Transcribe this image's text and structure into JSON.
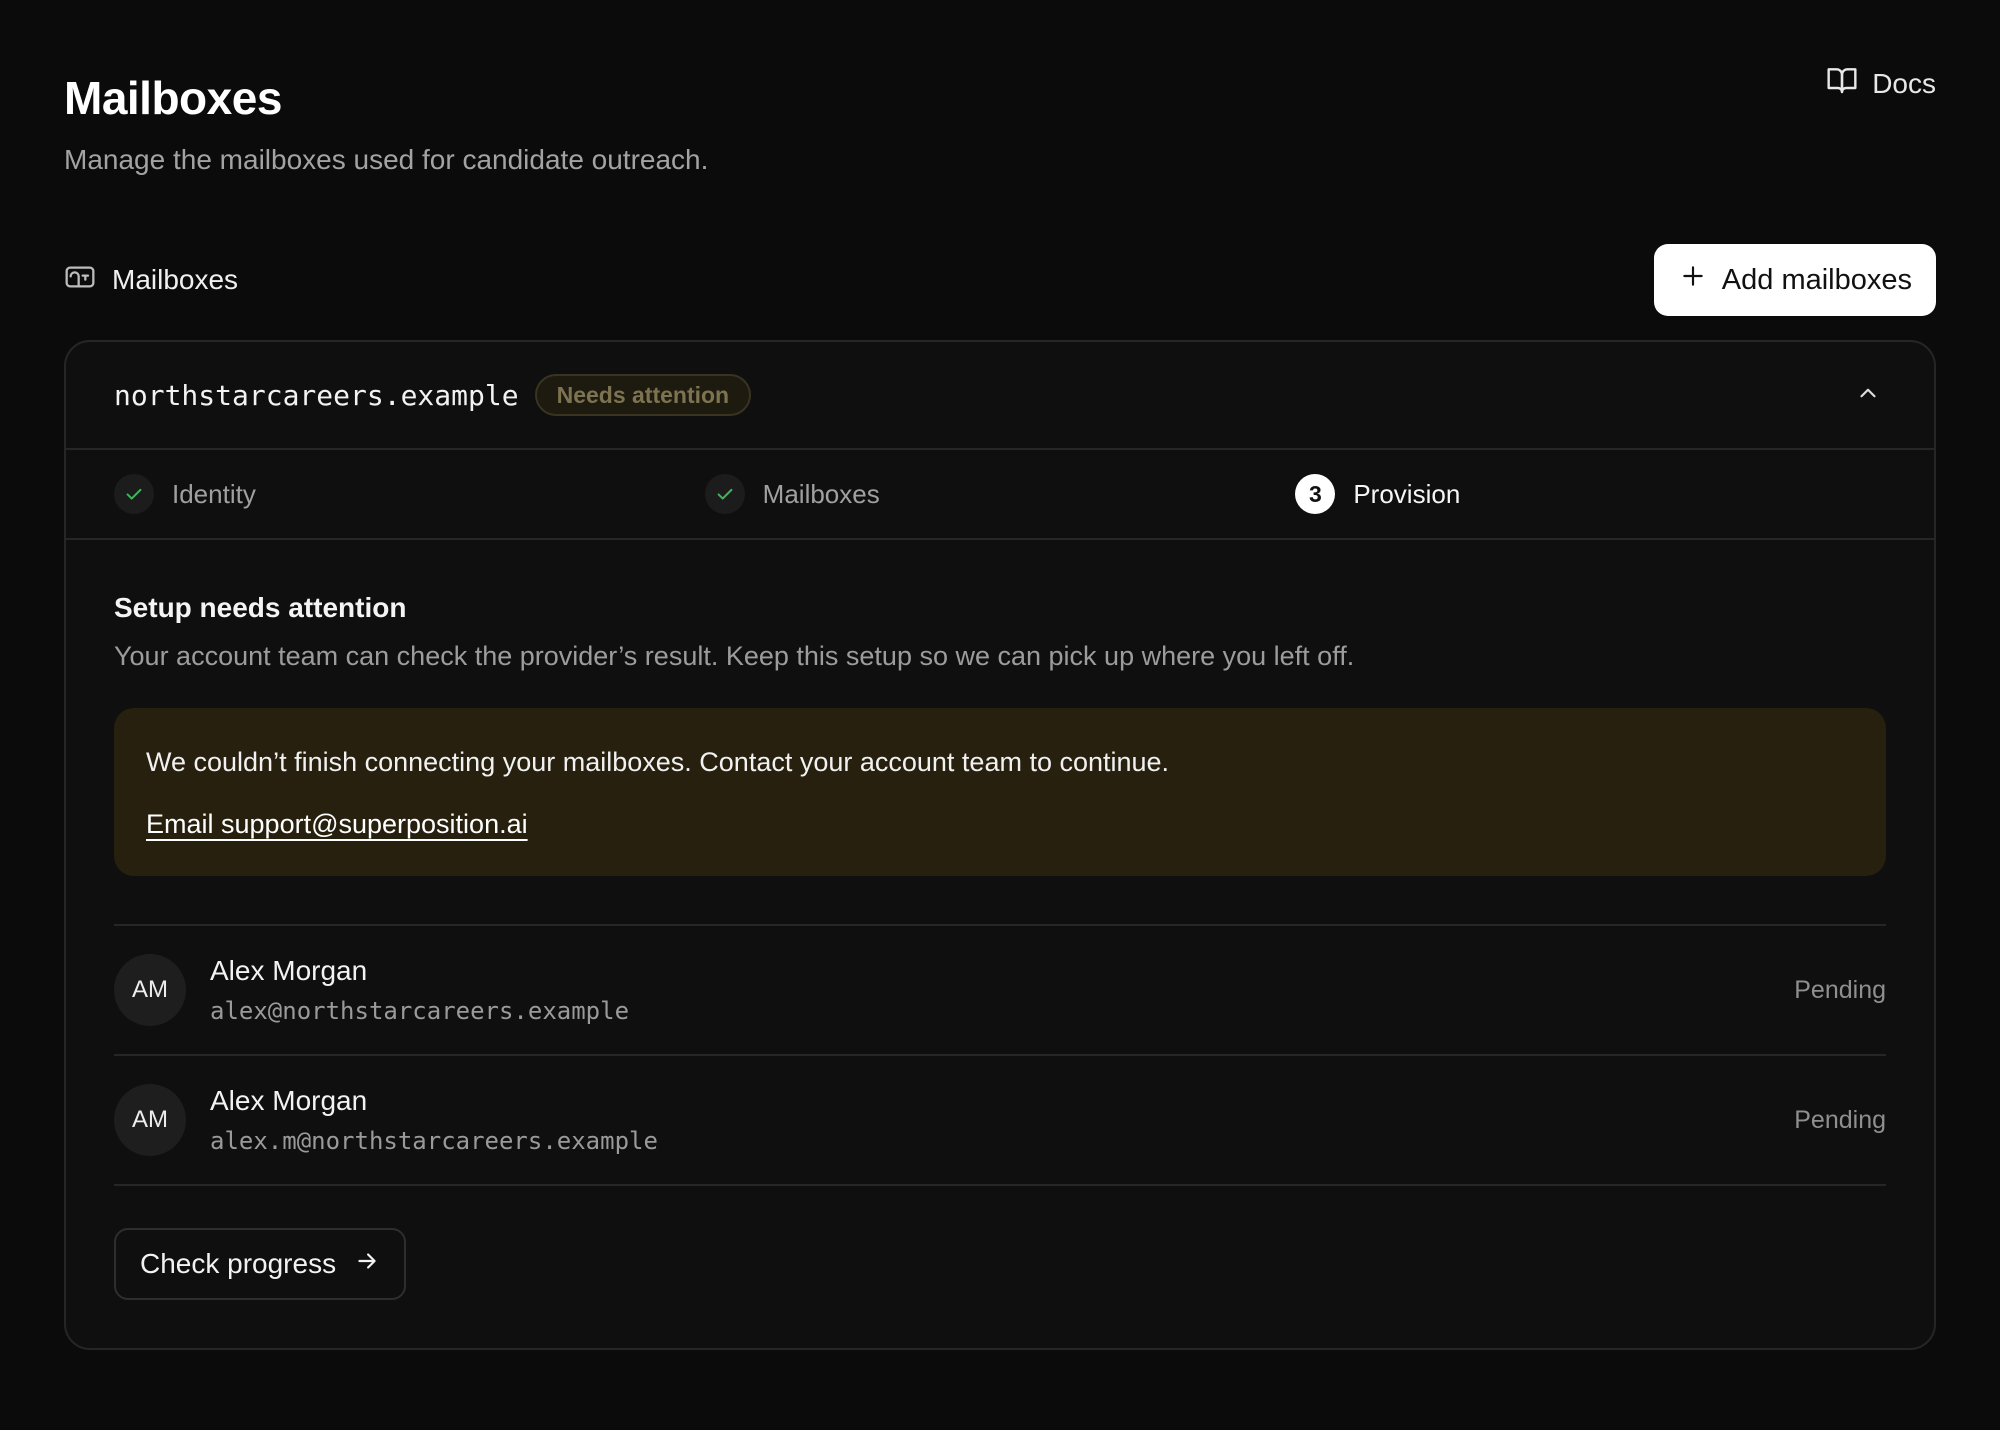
{
  "header": {
    "title": "Mailboxes",
    "subtitle": "Manage the mailboxes used for candidate outreach.",
    "docs_label": "Docs"
  },
  "section": {
    "label": "Mailboxes",
    "add_label": "Add mailboxes"
  },
  "card": {
    "domain": "northstarcareers.example",
    "status": "Needs attention",
    "steps": [
      {
        "label": "Identity",
        "state": "done"
      },
      {
        "label": "Mailboxes",
        "state": "done"
      },
      {
        "label": "Provision",
        "state": "active",
        "number": "3"
      }
    ],
    "body_title": "Setup needs attention",
    "body_desc": "Your account team can check the provider’s result. Keep this setup so we can pick up where you left off.",
    "alert_text": "We couldn’t finish connecting your mailboxes. Contact your account team to continue.",
    "alert_link": "Email support@superposition.ai",
    "mailboxes": [
      {
        "initials": "AM",
        "name": "Alex Morgan",
        "email": "alex@northstarcareers.example",
        "status": "Pending"
      },
      {
        "initials": "AM",
        "name": "Alex Morgan",
        "email": "alex.m@northstarcareers.example",
        "status": "Pending"
      }
    ],
    "check_label": "Check progress"
  },
  "colors": {
    "background": "#0b0b0b",
    "card_border": "#262626",
    "alert_bg": "#27200f",
    "pill_text": "#7d7350",
    "check_green": "#3fb45a"
  },
  "icons": {
    "docs": "book-open-icon",
    "section": "mailbox-icon",
    "add": "plus-icon",
    "collapse": "chevron-up-icon",
    "step_done": "check-icon",
    "check_progress": "arrow-right-icon"
  }
}
